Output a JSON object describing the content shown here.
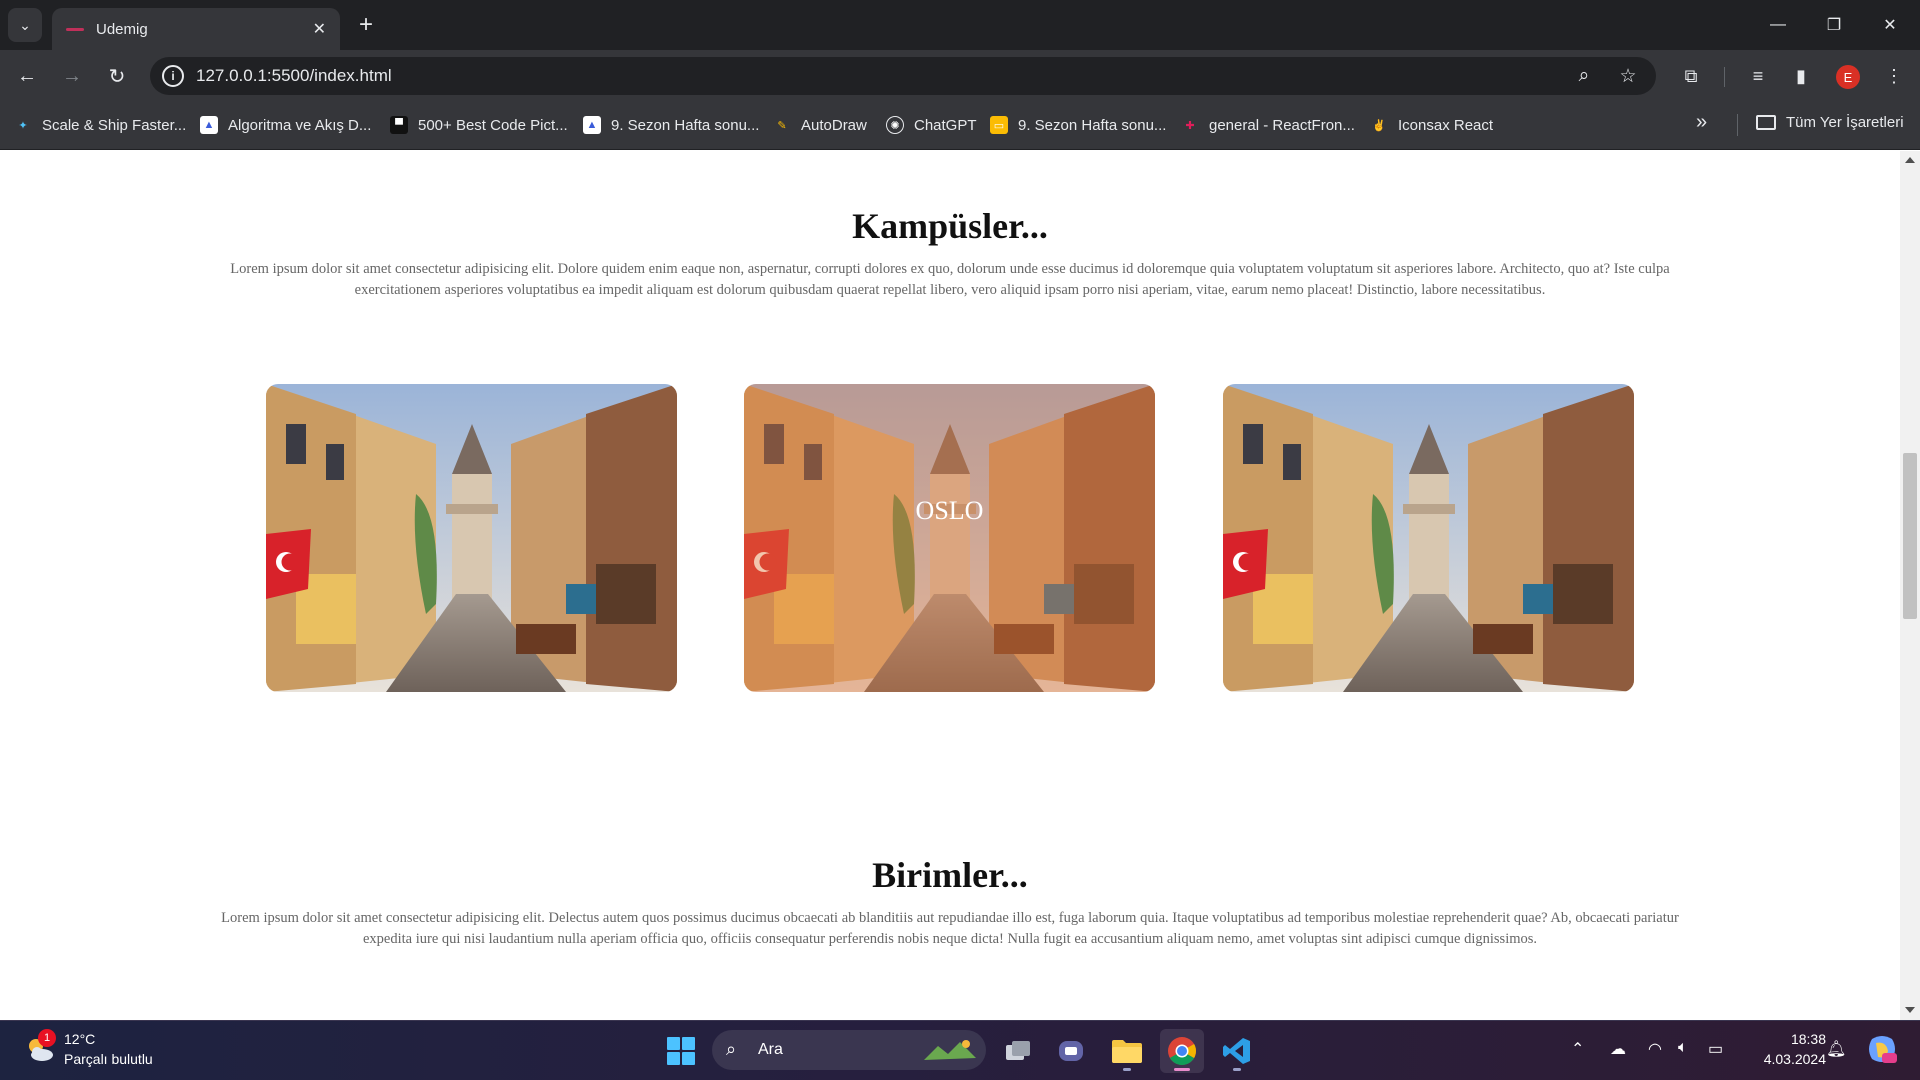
{
  "browser": {
    "tab_title": "Udemig",
    "url": "127.0.0.1:5500/index.html",
    "avatar_letter": "E",
    "bookmarks": [
      {
        "label": "Scale & Ship Faster...",
        "icon": "sparkle-icon"
      },
      {
        "label": "Algoritma ve Akış D...",
        "icon": "drawio-icon"
      },
      {
        "label": "500+ Best Code Pict...",
        "icon": "code-icon"
      },
      {
        "label": "9. Sezon Hafta sonu...",
        "icon": "drawio-icon"
      },
      {
        "label": "AutoDraw",
        "icon": "pencil-icon"
      },
      {
        "label": "ChatGPT",
        "icon": "chatgpt-icon"
      },
      {
        "label": "9. Sezon Hafta sonu...",
        "icon": "slides-icon"
      },
      {
        "label": "general - ReactFron...",
        "icon": "slack-icon"
      },
      {
        "label": "Iconsax React",
        "icon": "victory-hand-icon"
      }
    ],
    "all_bookmarks_label": "Tüm Yer İşaretleri"
  },
  "page": {
    "campuses": {
      "title": "Kampüsler...",
      "text": "Lorem ipsum dolor sit amet consectetur adipisicing elit. Dolore quidem enim eaque non, aspernatur, corrupti dolores ex quo, dolorum unde esse ducimus id doloremque quia voluptatem voluptatum sit asperiores labore. Architecto, quo at? Iste culpa exercitationem asperiores voluptatibus ea impedit aliquam est dolorum quibusdam quaerat repellat libero, vero aliquid ipsam porro nisi aperiam, vitae, earum nemo placeat! Distinctio, labore necessitatibus."
    },
    "cards": [
      {
        "label": "",
        "hovered": false
      },
      {
        "label": "OSLO",
        "hovered": true
      },
      {
        "label": "",
        "hovered": false
      }
    ],
    "units": {
      "title": "Birimler...",
      "text": "Lorem ipsum dolor sit amet consectetur adipisicing elit. Delectus autem quos possimus ducimus obcaecati ab blanditiis aut repudiandae illo est, fuga laborum quia. Itaque voluptatibus ad temporibus molestiae reprehenderit quae? Ab, obcaecati pariatur expedita iure qui nisi laudantium nulla aperiam officia quo, officiis consequatur perferendis nobis neque dicta! Nulla fugit ea accusantium aliquam nemo, amet voluptas sint adipisci cumque dignissimos."
    }
  },
  "taskbar": {
    "weather_temp": "12°C",
    "weather_desc": "Parçalı bulutlu",
    "weather_badge": "1",
    "search_placeholder": "Ara",
    "time": "18:38",
    "date": "4.03.2024"
  }
}
